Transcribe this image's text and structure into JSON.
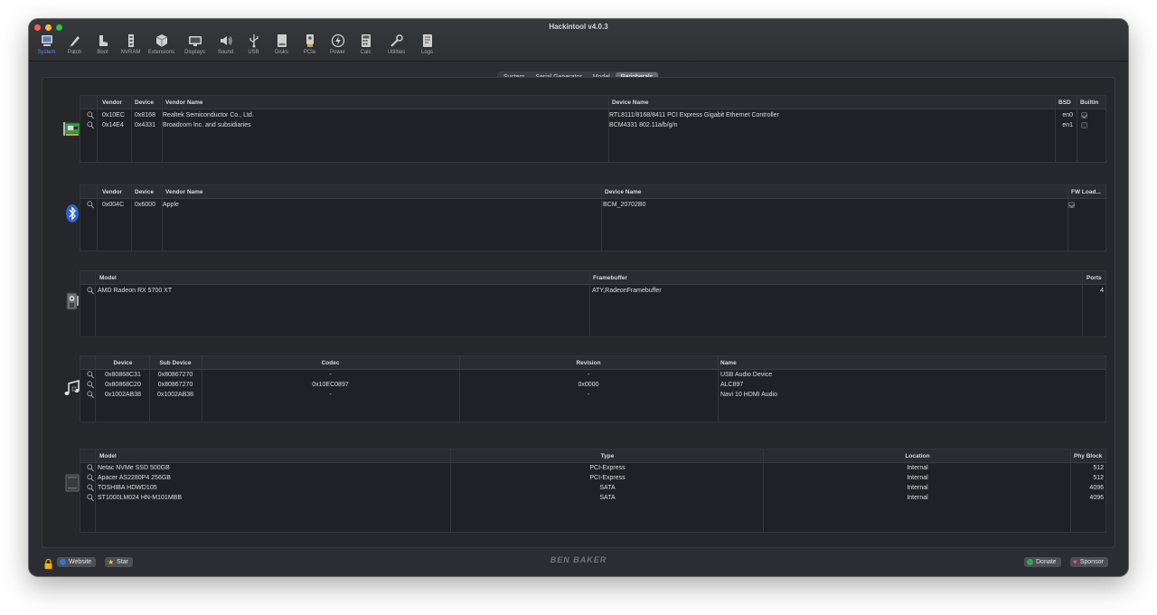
{
  "window": {
    "title": "Hackintool v4.0.3"
  },
  "toolbar": [
    {
      "label": "System",
      "icon": "system-icon",
      "active": true
    },
    {
      "label": "Patch",
      "icon": "patch-icon"
    },
    {
      "label": "Boot",
      "icon": "boot-icon"
    },
    {
      "label": "NVRAM",
      "icon": "nvram-icon"
    },
    {
      "label": "Extensions",
      "icon": "extensions-icon"
    },
    {
      "label": "Displays",
      "icon": "displays-icon"
    },
    {
      "label": "Sound",
      "icon": "sound-icon"
    },
    {
      "label": "USB",
      "icon": "usb-icon"
    },
    {
      "label": "Disks",
      "icon": "disks-icon"
    },
    {
      "label": "PCIe",
      "icon": "pcie-icon"
    },
    {
      "label": "Power",
      "icon": "power-icon"
    },
    {
      "label": "Calc",
      "icon": "calc-icon"
    },
    {
      "label": "Utilities",
      "icon": "utilities-icon"
    },
    {
      "label": "Logs",
      "icon": "logs-icon"
    }
  ],
  "tabs": [
    "System",
    "Serial Generator",
    "Model",
    "Peripherals"
  ],
  "active_tab": "Peripherals",
  "network": {
    "headers": {
      "vendor": "Vendor",
      "device": "Device",
      "vendor_name": "Vendor Name",
      "device_name": "Device Name",
      "bsd": "BSD",
      "builtin": "Builtin"
    },
    "rows": [
      {
        "vendor": "0x10EC",
        "device": "0x8168",
        "vendor_name": "Realtek Semiconductor Co., Ltd.",
        "device_name": "RTL8111/8168/8411 PCI Express Gigabit Ethernet Controller",
        "bsd": "en0",
        "builtin": true
      },
      {
        "vendor": "0x14E4",
        "device": "0x4331",
        "vendor_name": "Broadcom Inc. and subsidiaries",
        "device_name": "BCM4331 802.11a/b/g/n",
        "bsd": "en1",
        "builtin": false
      }
    ]
  },
  "bluetooth": {
    "headers": {
      "vendor": "Vendor",
      "device": "Device",
      "vendor_name": "Vendor Name",
      "device_name": "Device Name",
      "fw_load": "FW Load..."
    },
    "rows": [
      {
        "vendor": "0x004C",
        "device": "0x6000",
        "vendor_name": "Apple",
        "device_name": "BCM_20702B0",
        "fw_load": true
      }
    ]
  },
  "graphics": {
    "headers": {
      "model": "Model",
      "framebuffer": "Framebuffer",
      "ports": "Ports"
    },
    "rows": [
      {
        "model": "AMD Radeon RX 5700 XT",
        "framebuffer": "ATY,RadeonFramebuffer",
        "ports": "4"
      }
    ]
  },
  "audio": {
    "headers": {
      "device": "Device",
      "sub_device": "Sub Device",
      "codec": "Codec",
      "revision": "Revision",
      "name": "Name"
    },
    "rows": [
      {
        "device": "0x80868C31",
        "sub_device": "0x80867270",
        "codec": "-",
        "revision": "-",
        "name": "USB Audio Device"
      },
      {
        "device": "0x80868C20",
        "sub_device": "0x80867270",
        "codec": "0x10EC0897",
        "revision": "0x0000",
        "name": "ALC897"
      },
      {
        "device": "0x1002AB38",
        "sub_device": "0x1002AB38",
        "codec": "-",
        "revision": "-",
        "name": "Navi 10 HDMI Audio"
      }
    ]
  },
  "storage": {
    "headers": {
      "model": "Model",
      "type": "Type",
      "location": "Location",
      "phy_block": "Phy Block"
    },
    "rows": [
      {
        "model": "Netac NVMe SSD 500GB",
        "type": "PCI-Express",
        "location": "Internal",
        "phy_block": "512"
      },
      {
        "model": "Apacer AS2280P4 256GB",
        "type": "PCI-Express",
        "location": "Internal",
        "phy_block": "512"
      },
      {
        "model": "TOSHIBA HDWD105",
        "type": "SATA",
        "location": "Internal",
        "phy_block": "4096"
      },
      {
        "model": "ST1000LM024 HN-M101MBB",
        "type": "SATA",
        "location": "Internal",
        "phy_block": "4096"
      }
    ]
  },
  "footer": {
    "website": "Website",
    "star": "Star",
    "logo": "BEN BAKER",
    "donate": "Donate",
    "sponsor": "Sponsor"
  },
  "colors": {
    "accent": "#4d8dff",
    "window_bg": "#2b2d33",
    "panel_bg": "#1f2126"
  }
}
